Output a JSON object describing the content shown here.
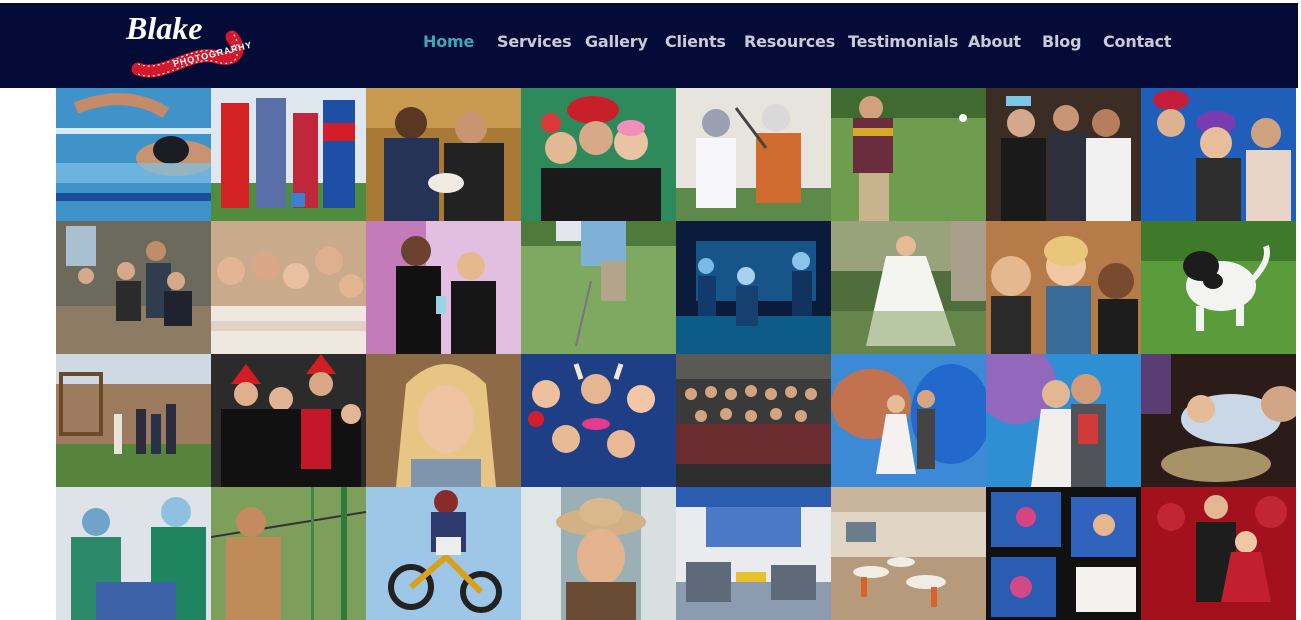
{
  "brand": {
    "name": "Blake",
    "tagline": "PHOTOGRAPHY",
    "colors": {
      "navbar": "#040b36",
      "nav_text": "#c9ccd6",
      "nav_active": "#3fa6b5",
      "logo_red": "#d3182b"
    }
  },
  "nav": {
    "items": [
      {
        "label": "Home",
        "active": true
      },
      {
        "label": "Services",
        "active": false
      },
      {
        "label": "Gallery",
        "active": false
      },
      {
        "label": "Clients",
        "active": false
      },
      {
        "label": "Resources",
        "active": false
      },
      {
        "label": "Testimonials",
        "active": false
      },
      {
        "label": "About",
        "active": false
      },
      {
        "label": "Blog",
        "active": false
      },
      {
        "label": "Contact",
        "active": false
      }
    ]
  },
  "gallery": {
    "photos": [
      {
        "subject": "swimmer-butterfly"
      },
      {
        "subject": "superhero-costumes"
      },
      {
        "subject": "two-men-with-football"
      },
      {
        "subject": "photo-booth-props-women"
      },
      {
        "subject": "lacrosse-game"
      },
      {
        "subject": "golfer-swing"
      },
      {
        "subject": "men-group-party"
      },
      {
        "subject": "photo-booth-hats"
      },
      {
        "subject": "family-by-waterfall"
      },
      {
        "subject": "bridesmaids-bathtub"
      },
      {
        "subject": "award-presentation"
      },
      {
        "subject": "golfer-putting"
      },
      {
        "subject": "band-on-stage-blue"
      },
      {
        "subject": "bride-dress-twirl"
      },
      {
        "subject": "laughing-audience"
      },
      {
        "subject": "puppy-running-grass"
      },
      {
        "subject": "family-backyard-playset"
      },
      {
        "subject": "holiday-party-santa-hats"
      },
      {
        "subject": "blonde-headshot"
      },
      {
        "subject": "photo-booth-viking-horns"
      },
      {
        "subject": "large-group-photo"
      },
      {
        "subject": "wedding-blue-smoke"
      },
      {
        "subject": "couple-kiss-smoke"
      },
      {
        "subject": "baby-baptism"
      },
      {
        "subject": "surgeons-operating"
      },
      {
        "subject": "zip-line-adventure"
      },
      {
        "subject": "motocross-jump"
      },
      {
        "subject": "cowgirl-waterfall"
      },
      {
        "subject": "office-interior-blue"
      },
      {
        "subject": "dining-hall-interior"
      },
      {
        "subject": "photo-booth-strips"
      },
      {
        "subject": "father-daughter-dance"
      }
    ]
  }
}
